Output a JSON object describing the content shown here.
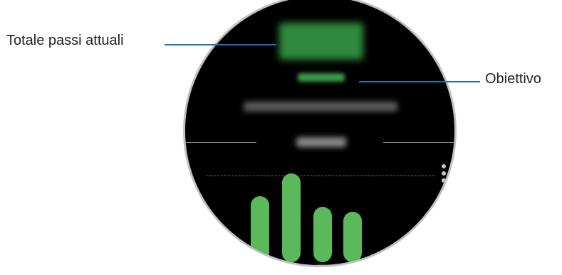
{
  "callouts": {
    "current_steps": "Totale passi attuali",
    "goal": "Obiettivo"
  },
  "chart_data": {
    "type": "bar",
    "categories": [
      "",
      "",
      "",
      ""
    ],
    "values": [
      0.62,
      0.83,
      0.52,
      0.47
    ],
    "colors": [
      "#5ab95a"
    ]
  },
  "watch": {
    "more_options_icon": "vertical-ellipsis-icon"
  }
}
